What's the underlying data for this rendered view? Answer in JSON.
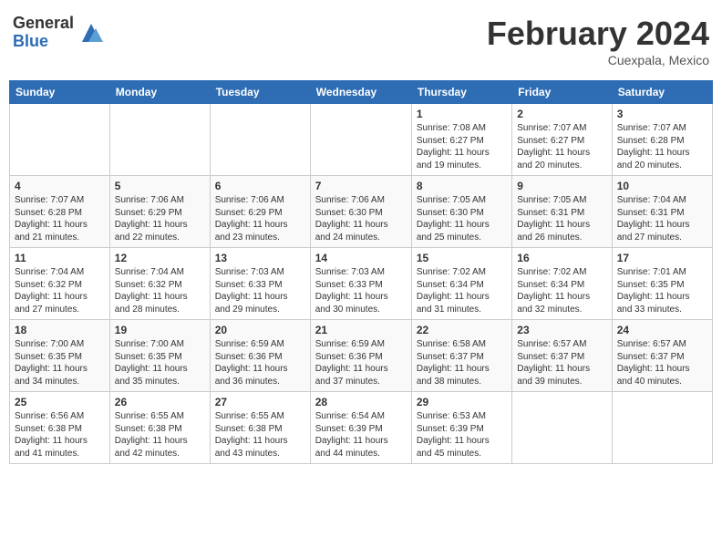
{
  "header": {
    "logo_general": "General",
    "logo_blue": "Blue",
    "month_title": "February 2024",
    "subtitle": "Cuexpala, Mexico"
  },
  "days_of_week": [
    "Sunday",
    "Monday",
    "Tuesday",
    "Wednesday",
    "Thursday",
    "Friday",
    "Saturday"
  ],
  "weeks": [
    {
      "days": [
        {
          "number": "",
          "info": ""
        },
        {
          "number": "",
          "info": ""
        },
        {
          "number": "",
          "info": ""
        },
        {
          "number": "",
          "info": ""
        },
        {
          "number": "1",
          "info": "Sunrise: 7:08 AM\nSunset: 6:27 PM\nDaylight: 11 hours\nand 19 minutes."
        },
        {
          "number": "2",
          "info": "Sunrise: 7:07 AM\nSunset: 6:27 PM\nDaylight: 11 hours\nand 20 minutes."
        },
        {
          "number": "3",
          "info": "Sunrise: 7:07 AM\nSunset: 6:28 PM\nDaylight: 11 hours\nand 20 minutes."
        }
      ]
    },
    {
      "days": [
        {
          "number": "4",
          "info": "Sunrise: 7:07 AM\nSunset: 6:28 PM\nDaylight: 11 hours\nand 21 minutes."
        },
        {
          "number": "5",
          "info": "Sunrise: 7:06 AM\nSunset: 6:29 PM\nDaylight: 11 hours\nand 22 minutes."
        },
        {
          "number": "6",
          "info": "Sunrise: 7:06 AM\nSunset: 6:29 PM\nDaylight: 11 hours\nand 23 minutes."
        },
        {
          "number": "7",
          "info": "Sunrise: 7:06 AM\nSunset: 6:30 PM\nDaylight: 11 hours\nand 24 minutes."
        },
        {
          "number": "8",
          "info": "Sunrise: 7:05 AM\nSunset: 6:30 PM\nDaylight: 11 hours\nand 25 minutes."
        },
        {
          "number": "9",
          "info": "Sunrise: 7:05 AM\nSunset: 6:31 PM\nDaylight: 11 hours\nand 26 minutes."
        },
        {
          "number": "10",
          "info": "Sunrise: 7:04 AM\nSunset: 6:31 PM\nDaylight: 11 hours\nand 27 minutes."
        }
      ]
    },
    {
      "days": [
        {
          "number": "11",
          "info": "Sunrise: 7:04 AM\nSunset: 6:32 PM\nDaylight: 11 hours\nand 27 minutes."
        },
        {
          "number": "12",
          "info": "Sunrise: 7:04 AM\nSunset: 6:32 PM\nDaylight: 11 hours\nand 28 minutes."
        },
        {
          "number": "13",
          "info": "Sunrise: 7:03 AM\nSunset: 6:33 PM\nDaylight: 11 hours\nand 29 minutes."
        },
        {
          "number": "14",
          "info": "Sunrise: 7:03 AM\nSunset: 6:33 PM\nDaylight: 11 hours\nand 30 minutes."
        },
        {
          "number": "15",
          "info": "Sunrise: 7:02 AM\nSunset: 6:34 PM\nDaylight: 11 hours\nand 31 minutes."
        },
        {
          "number": "16",
          "info": "Sunrise: 7:02 AM\nSunset: 6:34 PM\nDaylight: 11 hours\nand 32 minutes."
        },
        {
          "number": "17",
          "info": "Sunrise: 7:01 AM\nSunset: 6:35 PM\nDaylight: 11 hours\nand 33 minutes."
        }
      ]
    },
    {
      "days": [
        {
          "number": "18",
          "info": "Sunrise: 7:00 AM\nSunset: 6:35 PM\nDaylight: 11 hours\nand 34 minutes."
        },
        {
          "number": "19",
          "info": "Sunrise: 7:00 AM\nSunset: 6:35 PM\nDaylight: 11 hours\nand 35 minutes."
        },
        {
          "number": "20",
          "info": "Sunrise: 6:59 AM\nSunset: 6:36 PM\nDaylight: 11 hours\nand 36 minutes."
        },
        {
          "number": "21",
          "info": "Sunrise: 6:59 AM\nSunset: 6:36 PM\nDaylight: 11 hours\nand 37 minutes."
        },
        {
          "number": "22",
          "info": "Sunrise: 6:58 AM\nSunset: 6:37 PM\nDaylight: 11 hours\nand 38 minutes."
        },
        {
          "number": "23",
          "info": "Sunrise: 6:57 AM\nSunset: 6:37 PM\nDaylight: 11 hours\nand 39 minutes."
        },
        {
          "number": "24",
          "info": "Sunrise: 6:57 AM\nSunset: 6:37 PM\nDaylight: 11 hours\nand 40 minutes."
        }
      ]
    },
    {
      "days": [
        {
          "number": "25",
          "info": "Sunrise: 6:56 AM\nSunset: 6:38 PM\nDaylight: 11 hours\nand 41 minutes."
        },
        {
          "number": "26",
          "info": "Sunrise: 6:55 AM\nSunset: 6:38 PM\nDaylight: 11 hours\nand 42 minutes."
        },
        {
          "number": "27",
          "info": "Sunrise: 6:55 AM\nSunset: 6:38 PM\nDaylight: 11 hours\nand 43 minutes."
        },
        {
          "number": "28",
          "info": "Sunrise: 6:54 AM\nSunset: 6:39 PM\nDaylight: 11 hours\nand 44 minutes."
        },
        {
          "number": "29",
          "info": "Sunrise: 6:53 AM\nSunset: 6:39 PM\nDaylight: 11 hours\nand 45 minutes."
        },
        {
          "number": "",
          "info": ""
        },
        {
          "number": "",
          "info": ""
        }
      ]
    }
  ]
}
